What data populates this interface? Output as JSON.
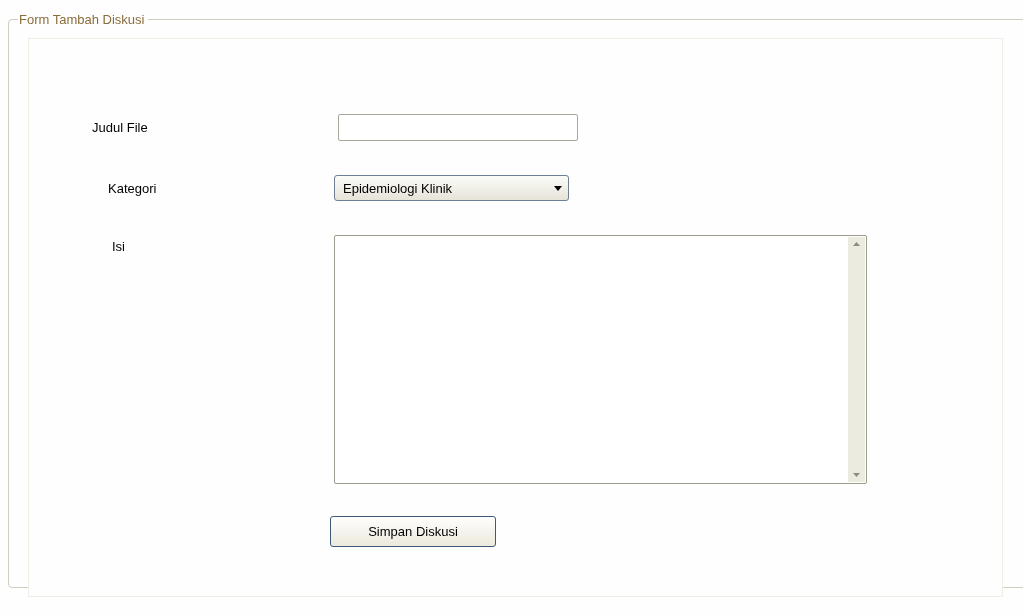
{
  "group": {
    "title": "Form Tambah Diskusi"
  },
  "fields": [
    {
      "kind": "text",
      "label": "Judul File"
    },
    {
      "kind": "select",
      "label": "Kategori",
      "value": "Epidemiologi Klinik"
    },
    {
      "kind": "textarea",
      "label": "Isi"
    }
  ],
  "buttons": [
    "Simpan Diskusi"
  ]
}
